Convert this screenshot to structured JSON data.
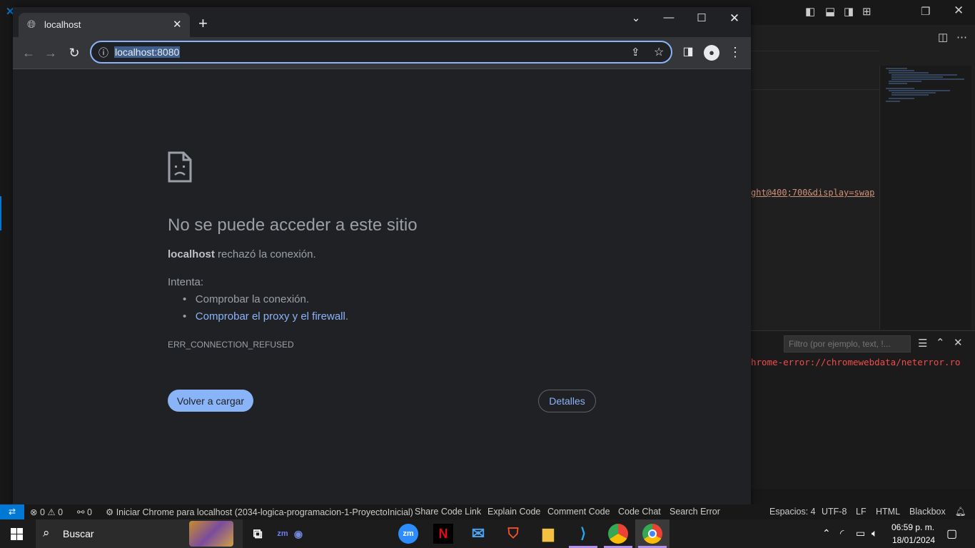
{
  "vscode": {
    "code_link": "ght@400;700&display=swap",
    "filter_placeholder": "Filtro (por ejemplo, text, !...",
    "error_line": "hrome-error://chromewebdata/neterror.ro"
  },
  "chrome": {
    "tab_title": "localhost",
    "url": "localhost:8080"
  },
  "error_page": {
    "title": "No se puede acceder a este sitio",
    "host": "localhost",
    "message": " rechazó la conexión.",
    "try_label": "Intenta:",
    "suggestion_1": "Comprobar la conexión.",
    "suggestion_2_link": "Comprobar el proxy y el firewall",
    "suggestion_2_suffix": ".",
    "error_code": "ERR_CONNECTION_REFUSED",
    "reload_label": "Volver a cargar",
    "details_label": "Detalles"
  },
  "statusbar": {
    "errors": "0",
    "warnings": "0",
    "ports": "0",
    "task": "Iniciar Chrome para localhost (2034-logica-programacion-1-ProyectoInicial)",
    "share": "Share Code Link",
    "explain": "Explain Code",
    "comment": "Comment Code",
    "chat": "Code Chat",
    "search_error": "Search Error",
    "spaces": "Espacios: 4",
    "encoding": "UTF-8",
    "eol": "LF",
    "language": "HTML",
    "blackbox": "Blackbox"
  },
  "taskbar": {
    "search_placeholder": "Buscar",
    "time": "06:59 p. m.",
    "date": "18/01/2024"
  },
  "colors": {
    "accent": "#8ab4f8",
    "vscode_blue": "#0078d4",
    "error_red": "#f14c4c"
  }
}
